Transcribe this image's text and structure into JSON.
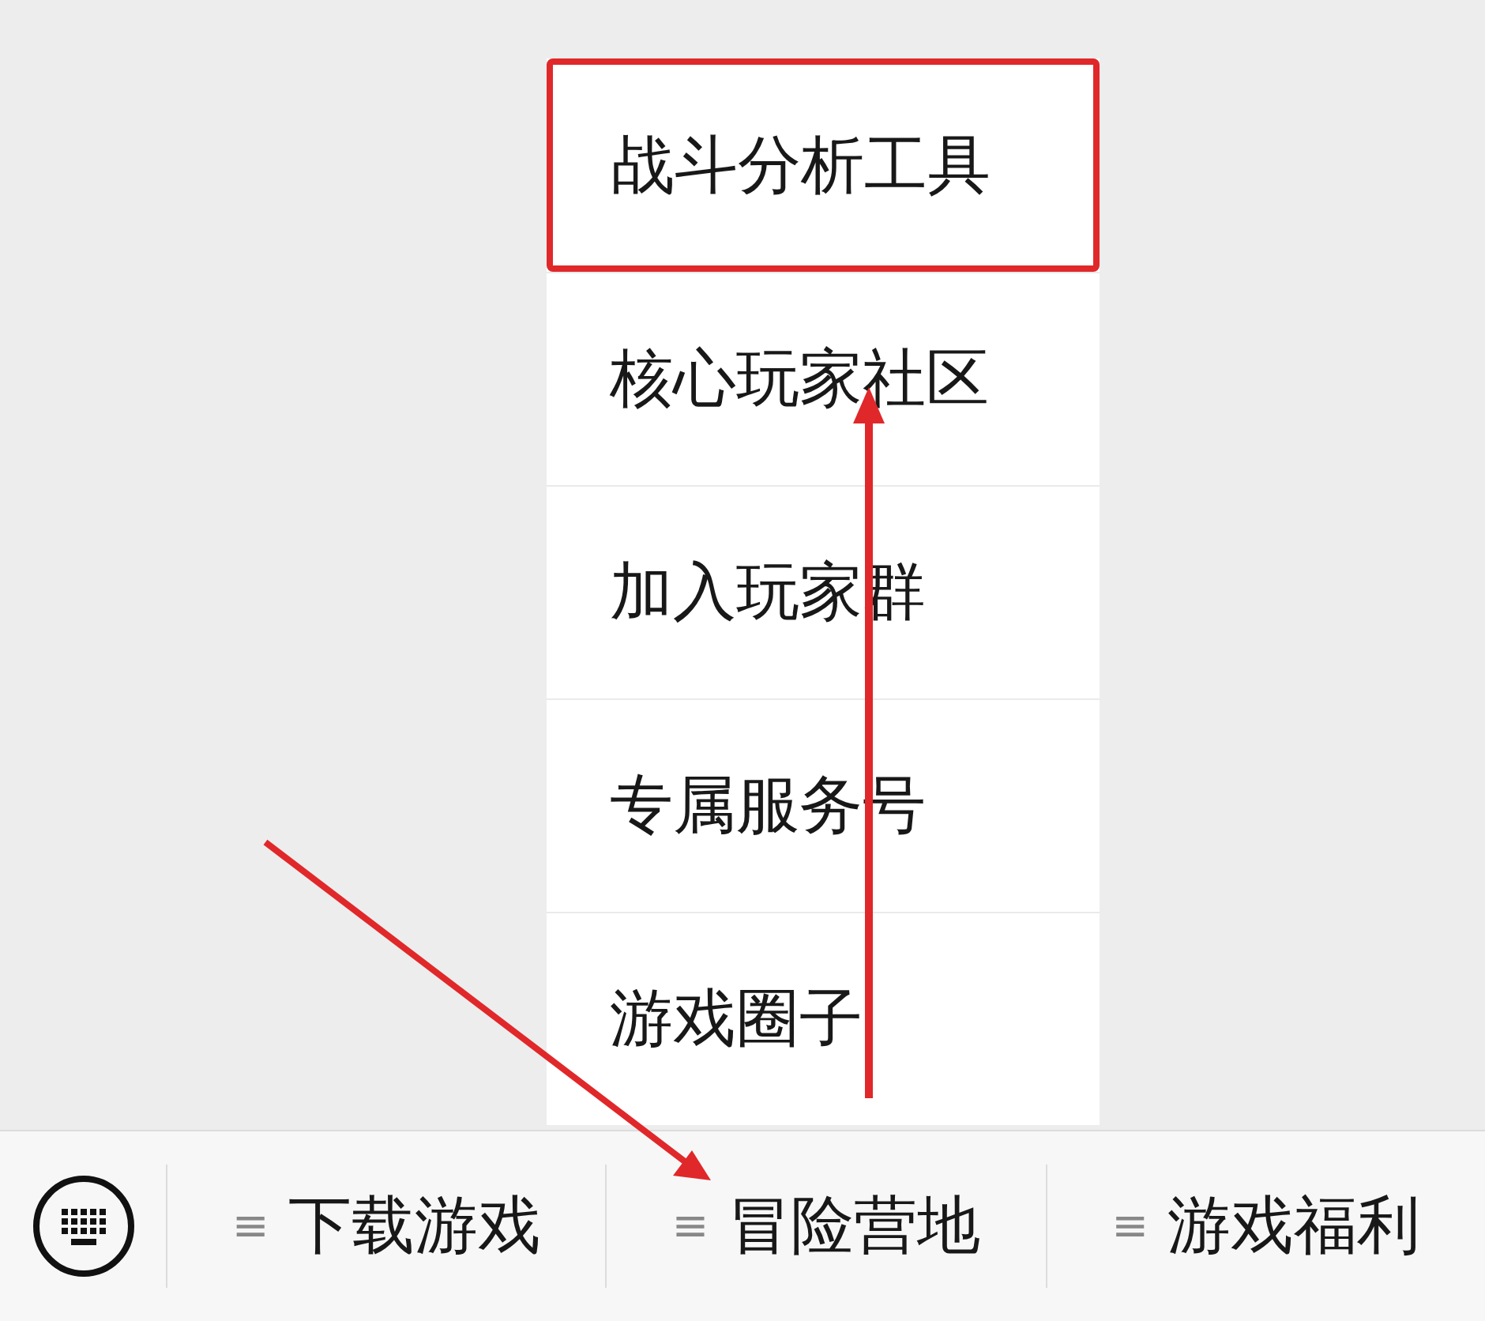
{
  "menu": {
    "items": [
      {
        "label": "战斗分析工具",
        "selected": true
      },
      {
        "label": "核心玩家社区",
        "selected": false
      },
      {
        "label": "加入玩家群",
        "selected": false
      },
      {
        "label": "专属服务号",
        "selected": false
      },
      {
        "label": "游戏圈子",
        "selected": false
      }
    ]
  },
  "bottom_bar": {
    "tabs": [
      {
        "label": "下载游戏",
        "icon": "≡"
      },
      {
        "label": "冒险营地",
        "icon": "≡"
      },
      {
        "label": "游戏福利",
        "icon": "≡"
      }
    ]
  }
}
